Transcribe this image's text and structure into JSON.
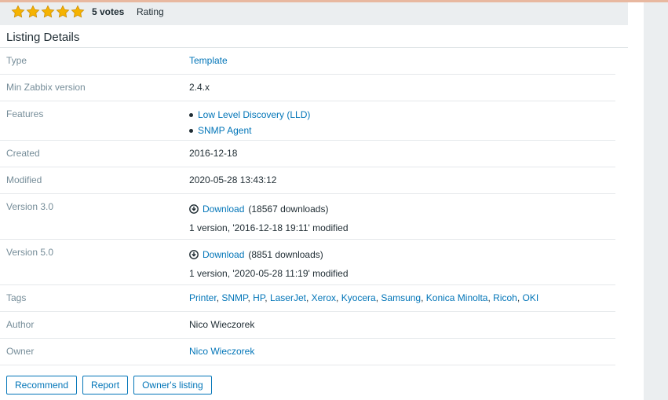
{
  "rating": {
    "stars_filled": 5,
    "stars_total": 5,
    "votes_text": "5 votes",
    "label": "Rating"
  },
  "section_title": "Listing Details",
  "details": {
    "type": {
      "label": "Type",
      "value": "Template"
    },
    "min_version": {
      "label": "Min Zabbix version",
      "value": "2.4.x"
    },
    "features": {
      "label": "Features",
      "items": [
        "Low Level Discovery (LLD)",
        "SNMP Agent"
      ]
    },
    "created": {
      "label": "Created",
      "value": "2016-12-18"
    },
    "modified": {
      "label": "Modified",
      "value": "2020-05-28 13:43:12"
    },
    "version_3": {
      "label": "Version 3.0",
      "download_label": "Download",
      "downloads_text": "(18567 downloads)",
      "meta": "1 version, '2016-12-18 19:11' modified"
    },
    "version_5": {
      "label": "Version 5.0",
      "download_label": "Download",
      "downloads_text": "(8851 downloads)",
      "meta": "1 version, '2020-05-28 11:19' modified"
    },
    "tags": {
      "label": "Tags",
      "items": [
        "Printer",
        "SNMP",
        "HP",
        "LaserJet",
        "Xerox",
        "Kyocera",
        "Samsung",
        "Konica Minolta",
        "Ricoh",
        "OKI"
      ]
    },
    "author": {
      "label": "Author",
      "value": "Nico Wieczorek"
    },
    "owner": {
      "label": "Owner",
      "value": "Nico Wieczorek"
    }
  },
  "buttons": {
    "recommend": "Recommend",
    "report": "Report",
    "owners_listing": "Owner's listing"
  },
  "colors": {
    "link": "#0275b8",
    "star": "#f5b301",
    "label": "#768d99",
    "panel": "#ebeef0"
  }
}
